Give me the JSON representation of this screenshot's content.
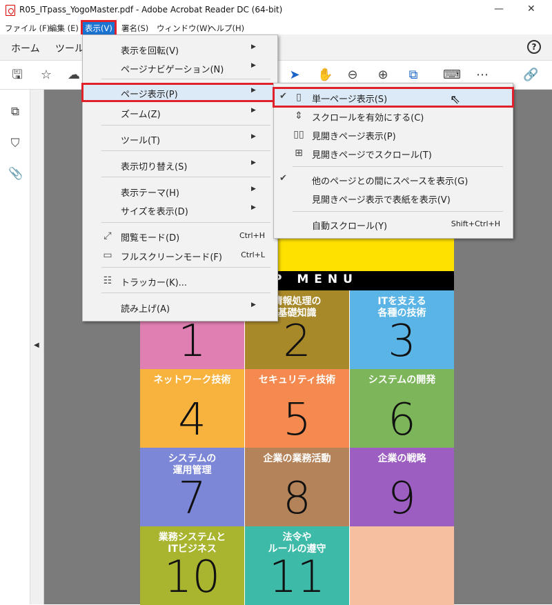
{
  "window": {
    "title": "R05_ITpass_YogoMaster.pdf - Adobe Acrobat Reader DC (64-bit)",
    "minimize": "—",
    "close": "✕"
  },
  "menubar": [
    {
      "label": "ファイル (F)"
    },
    {
      "label": "編集 (E)"
    },
    {
      "label": "表示(V)"
    },
    {
      "label": "署名(S)"
    },
    {
      "label": "ウィンドウ(W)"
    },
    {
      "label": "ヘルプ(H)"
    }
  ],
  "tabs": {
    "home": "ホーム",
    "tools": "ツール"
  },
  "view_menu": {
    "rotate": "表示を回転(V)",
    "page_nav": "ページナビゲーション(N)",
    "page_display": "ページ表示(P)",
    "zoom": "ズーム(Z)",
    "tools": "ツール(T)",
    "show_hide": "表示切り替え(S)",
    "theme": "表示テーマ(H)",
    "display_size": "サイズを表示(D)",
    "read_mode": "閲覧モード(D)",
    "read_mode_shortcut": "Ctrl+H",
    "fullscreen": "フルスクリーンモード(F)",
    "fullscreen_shortcut": "Ctrl+L",
    "tracker": "トラッカー(K)...",
    "read_aloud": "読み上げ(A)"
  },
  "page_display_submenu": {
    "single_page": "単一ページ表示(S)",
    "enable_scroll": "スクロールを有効にする(C)",
    "two_page": "見開きページ表示(P)",
    "two_page_scroll": "見開きページでスクロール(T)",
    "show_gaps": "他のページとの間にスペースを表示(G)",
    "show_cover": "見開きページ表示で表紙を表示(V)",
    "auto_scroll": "自動スクロール(Y)",
    "auto_scroll_shortcut": "Shift+Ctrl+H"
  },
  "document": {
    "menu_banner": "P MENU",
    "tiles": [
      {
        "label": "",
        "number": "1",
        "color": "#df7fb2"
      },
      {
        "label": "情報処理の\n基礎知識",
        "number": "2",
        "color": "#a8892a"
      },
      {
        "label": "ITを支える\n各種の技術",
        "number": "3",
        "color": "#5ab4e5"
      },
      {
        "label": "ネットワーク技術",
        "number": "4",
        "color": "#f7b33e"
      },
      {
        "label": "セキュリティ技術",
        "number": "5",
        "color": "#f48a4f"
      },
      {
        "label": "システムの開発",
        "number": "6",
        "color": "#7cb55a"
      },
      {
        "label": "システムの\n運用管理",
        "number": "7",
        "color": "#7c87d8"
      },
      {
        "label": "企業の業務活動",
        "number": "8",
        "color": "#b5835a"
      },
      {
        "label": "企業の戦略",
        "number": "9",
        "color": "#9c5fc1"
      },
      {
        "label": "業務システムと\nITビジネス",
        "number": "10",
        "color": "#a9b52e"
      },
      {
        "label": "法令や\nルールの遵守",
        "number": "11",
        "color": "#3ebaa8"
      },
      {
        "label": "",
        "number": "",
        "color": "#f6c0a0"
      }
    ]
  },
  "colors": {
    "highlight_red": "#e0202a",
    "menu_active": "#1a73d1",
    "doc_bg": "#7b7b7b"
  }
}
